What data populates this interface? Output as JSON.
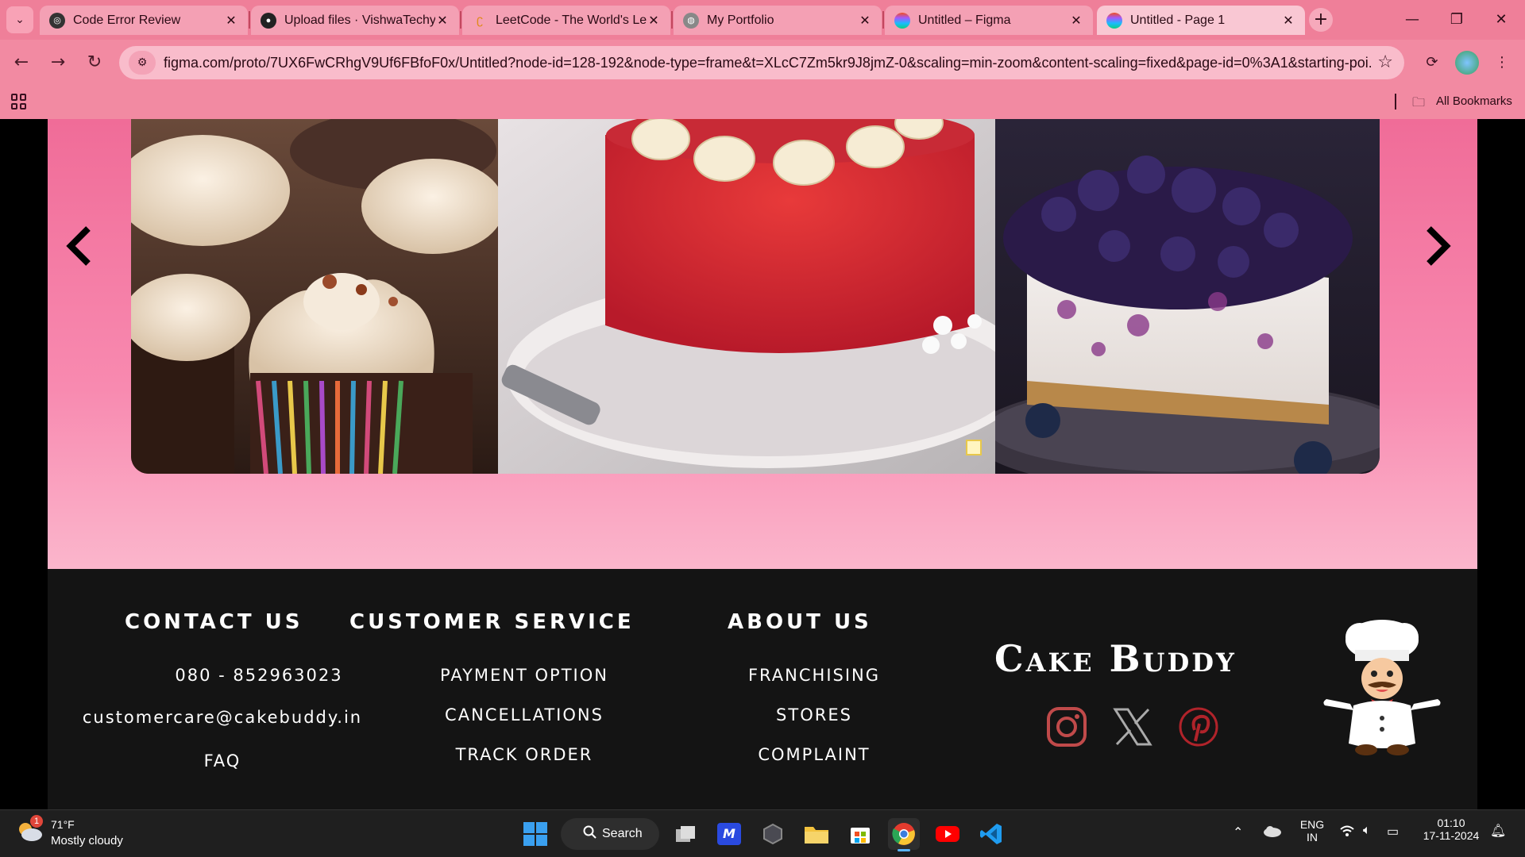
{
  "browser": {
    "tabs": [
      {
        "title": "Code Error Review",
        "icon": "chatgpt-icon"
      },
      {
        "title": "Upload files · VishwaTechy/",
        "icon": "github-icon"
      },
      {
        "title": "LeetCode - The World's Le",
        "icon": "leetcode-icon"
      },
      {
        "title": "My Portfolio",
        "icon": "globe-icon"
      },
      {
        "title": "Untitled – Figma",
        "icon": "figma-icon"
      },
      {
        "title": "Untitled - Page 1",
        "icon": "figma-icon",
        "active": true
      }
    ],
    "url": "figma.com/proto/7UX6FwCRhgV9Uf6FBfoF0x/Untitled?node-id=128-192&node-type=frame&t=XLcC7Zm5kr9J8jmZ-0&scaling=min-zoom&content-scaling=fixed&page-id=0%3A1&starting-poi...",
    "bookmarks_label": "All Bookmarks"
  },
  "page": {
    "gallery": {
      "images": [
        "cupcakes-photo",
        "red-velvet-cake-photo",
        "blueberry-cheesecake-photo"
      ],
      "prev_arrow": "‹",
      "next_arrow": "›"
    },
    "footer": {
      "contact": {
        "title": "CONTACT US",
        "phone": "080 - 852963023",
        "email": "customercare@cakebuddy.in",
        "faq": "FAQ"
      },
      "service": {
        "title": "CUSTOMER SERVICE",
        "items": [
          "PAYMENT OPTION",
          "CANCELLATIONS",
          "TRACK ORDER"
        ]
      },
      "about": {
        "title": "ABOUT US",
        "items": [
          "FRANCHISING",
          "STORES",
          "COMPLAINT"
        ]
      },
      "brand": "Cake Buddy",
      "social": [
        "instagram-icon",
        "x-icon",
        "pinterest-icon"
      ],
      "colors": {
        "background": "#141414",
        "pinterest": "#b0232a",
        "instagram": "#c04a4a"
      }
    }
  },
  "taskbar": {
    "weather_badge": "1",
    "weather_temp": "71°F",
    "weather_desc": "Mostly cloudy",
    "search_label": "Search",
    "lang_line1": "ENG",
    "lang_line2": "IN",
    "time": "01:10",
    "date": "17-11-2024"
  },
  "colors": {
    "hero_top": "#f06c98",
    "hero_bottom": "#fbb6cc",
    "chrome": "#f28aa2"
  }
}
